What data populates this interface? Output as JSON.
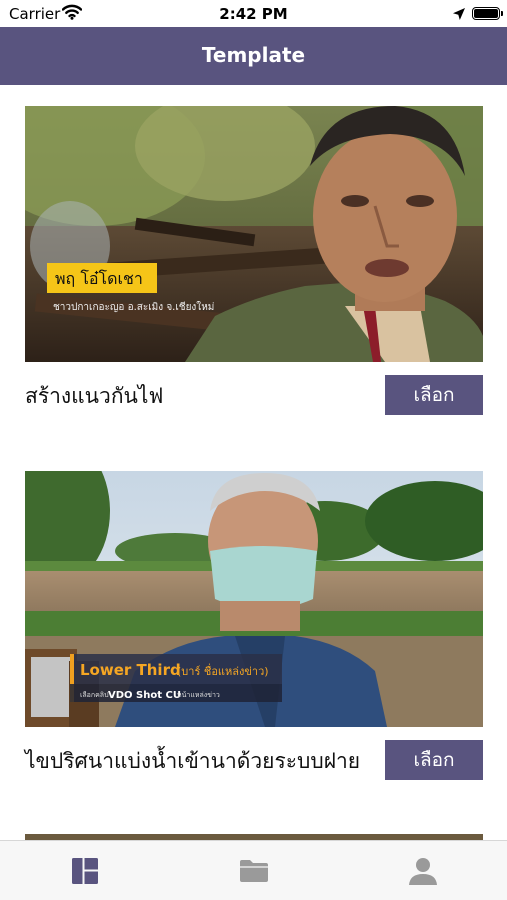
{
  "status_bar": {
    "carrier": "Carrier",
    "time": "2:42 PM"
  },
  "nav": {
    "title": "Template"
  },
  "colors": {
    "nav_background": "#59547f",
    "button_background": "#59547f",
    "tab_active": "#59547f",
    "tab_inactive": "#9a9a9a"
  },
  "templates": [
    {
      "title": "สร้างแนวกันไฟ",
      "button_label": "เลือก",
      "thumbnail": {
        "name_tag": "พฤ โอ๋โดเชา",
        "caption": "ชาวปกาเกอะญอ อ.สะเมิง จ.เชียงใหม่"
      }
    },
    {
      "title": "ไขปริศนาแบ่งน้ำเข้านาด้วยระบบฝาย",
      "button_label": "เลือก",
      "thumbnail": {
        "lower_third_main": "Lower Third",
        "lower_third_sub": "(บาร์ ชื่อแหล่งข่าว)",
        "small_prefix": "เลือกคลิป",
        "small_bold": "VDO Shot CU",
        "small_suffix": "หน้าแหล่งข่าว"
      }
    }
  ],
  "tab_bar": {
    "tabs": [
      {
        "icon": "template-grid-icon",
        "active": true
      },
      {
        "icon": "folder-icon",
        "active": false
      },
      {
        "icon": "person-icon",
        "active": false
      }
    ]
  }
}
